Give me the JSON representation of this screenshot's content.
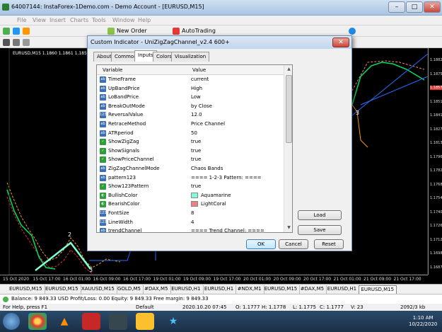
{
  "window": {
    "title": "64007144: InstaForex-1Demo.com - Demo Account - [EURUSD,M15]"
  },
  "menu": [
    "File",
    "View",
    "Insert",
    "Charts",
    "Tools",
    "Window",
    "Help"
  ],
  "toolbar": {
    "new_order": "New Order",
    "autotrading": "AutoTrading"
  },
  "chart": {
    "info": "EURUSD,M15  1.1860 1.1861 1.1857 1.1",
    "prices": [
      "1.1882",
      "1.1875",
      "1.1857",
      "1.1851",
      "1.1841",
      "1.1827",
      "1.1813",
      "1.1796",
      "1.1782",
      "1.1768",
      "1.1754",
      "1.1740",
      "1.1726",
      "1.1712",
      "1.1698",
      "1.1687"
    ],
    "highlight_prices": [
      "1.1857"
    ],
    "times": [
      "15 Oct 2020",
      "15 Oct 17:00",
      "16 Oct 01:00",
      "16 Oct 09:00",
      "16 Oct 17:00",
      "19 Oct 01:00",
      "19 Oct 09:00",
      "19 Oct 17:00",
      "20 Oct 01:00",
      "20 Oct 09:00",
      "20 Oct 17:00",
      "21 Oct 01:00",
      "21 Oct 09:00",
      "21 Oct 17:00"
    ],
    "zigzag_labels": [
      "2",
      "3",
      "3"
    ]
  },
  "chart_tabs": [
    "EURUSD,M15",
    "EURUSD,M15",
    "XAUUSD,M15",
    "GOLD,M5",
    "#DAX,M5",
    "EURUSD,H1",
    "EURUSD,H1",
    "#NDX,M1",
    "EURUSD,M15",
    "#DAX,M5",
    "EURUSD,H1",
    "EURUSD,M15"
  ],
  "balance_bar": "Balance: 9 849.33 USD  Profit/Loss: 0.00  Equity: 9 849.33  Free margin: 9 849.33",
  "status_bar": {
    "help": "For Help, press F1",
    "profile": "Default",
    "datetime": "2020.10.20 07:45",
    "open": "O: 1.1777",
    "high": "H: 1.1778",
    "low": "L: 1.1775",
    "close": "C: 1.1777",
    "volume": "V: 23",
    "traffic": "2092/3 kb"
  },
  "dialog": {
    "title": "Custom Indicator - UniZigZagChannel_v2.4 600+",
    "close_label": "✕",
    "tabs": [
      "About",
      "Common",
      "Inputs",
      "Colors",
      "Visualization"
    ],
    "active_tab": "Inputs",
    "columns": [
      "Variable",
      "Value"
    ],
    "rows": [
      {
        "icon": "ab",
        "name": "TimeFrame",
        "value": "current"
      },
      {
        "icon": "ab",
        "name": "UpBandPrice",
        "value": "High"
      },
      {
        "icon": "ab",
        "name": "LoBandPrice",
        "value": "Low"
      },
      {
        "icon": "ab",
        "name": "BreakOutMode",
        "value": "by Close"
      },
      {
        "icon": "num",
        "name": "ReversalValue",
        "value": "12.0"
      },
      {
        "icon": "ab",
        "name": "RetraceMethod",
        "value": "Price Channel"
      },
      {
        "icon": "ab",
        "name": "ATRperiod",
        "value": "50"
      },
      {
        "icon": "bool",
        "name": "ShowZigZag",
        "value": "true"
      },
      {
        "icon": "bool",
        "name": "ShowSignals",
        "value": "true"
      },
      {
        "icon": "bool",
        "name": "ShowPriceChannel",
        "value": "true"
      },
      {
        "icon": "ab",
        "name": "ZigZagChannelMode",
        "value": "Chaos Bands"
      },
      {
        "icon": "ab",
        "name": "pattern123",
        "value": "==== 1-2-3 Pattern: ===="
      },
      {
        "icon": "bool",
        "name": "Show123Pattern",
        "value": "true"
      },
      {
        "icon": "color",
        "name": "BullishColor",
        "value": "Aquamarine",
        "swatch": "#7fffd4"
      },
      {
        "icon": "color",
        "name": "BearishColor",
        "value": "LightCoral",
        "swatch": "#f08080"
      },
      {
        "icon": "num",
        "name": "FontSize",
        "value": "8"
      },
      {
        "icon": "num",
        "name": "LineWidth",
        "value": "4"
      },
      {
        "icon": "ab",
        "name": "trendChannel",
        "value": "==== Trend Channel: ===="
      }
    ],
    "buttons": {
      "load": "Load",
      "save": "Save",
      "ok": "OK",
      "cancel": "Cancel",
      "reset": "Reset"
    }
  },
  "taskbar": {
    "time": "1:10 AM",
    "date": "10/22/2020"
  }
}
